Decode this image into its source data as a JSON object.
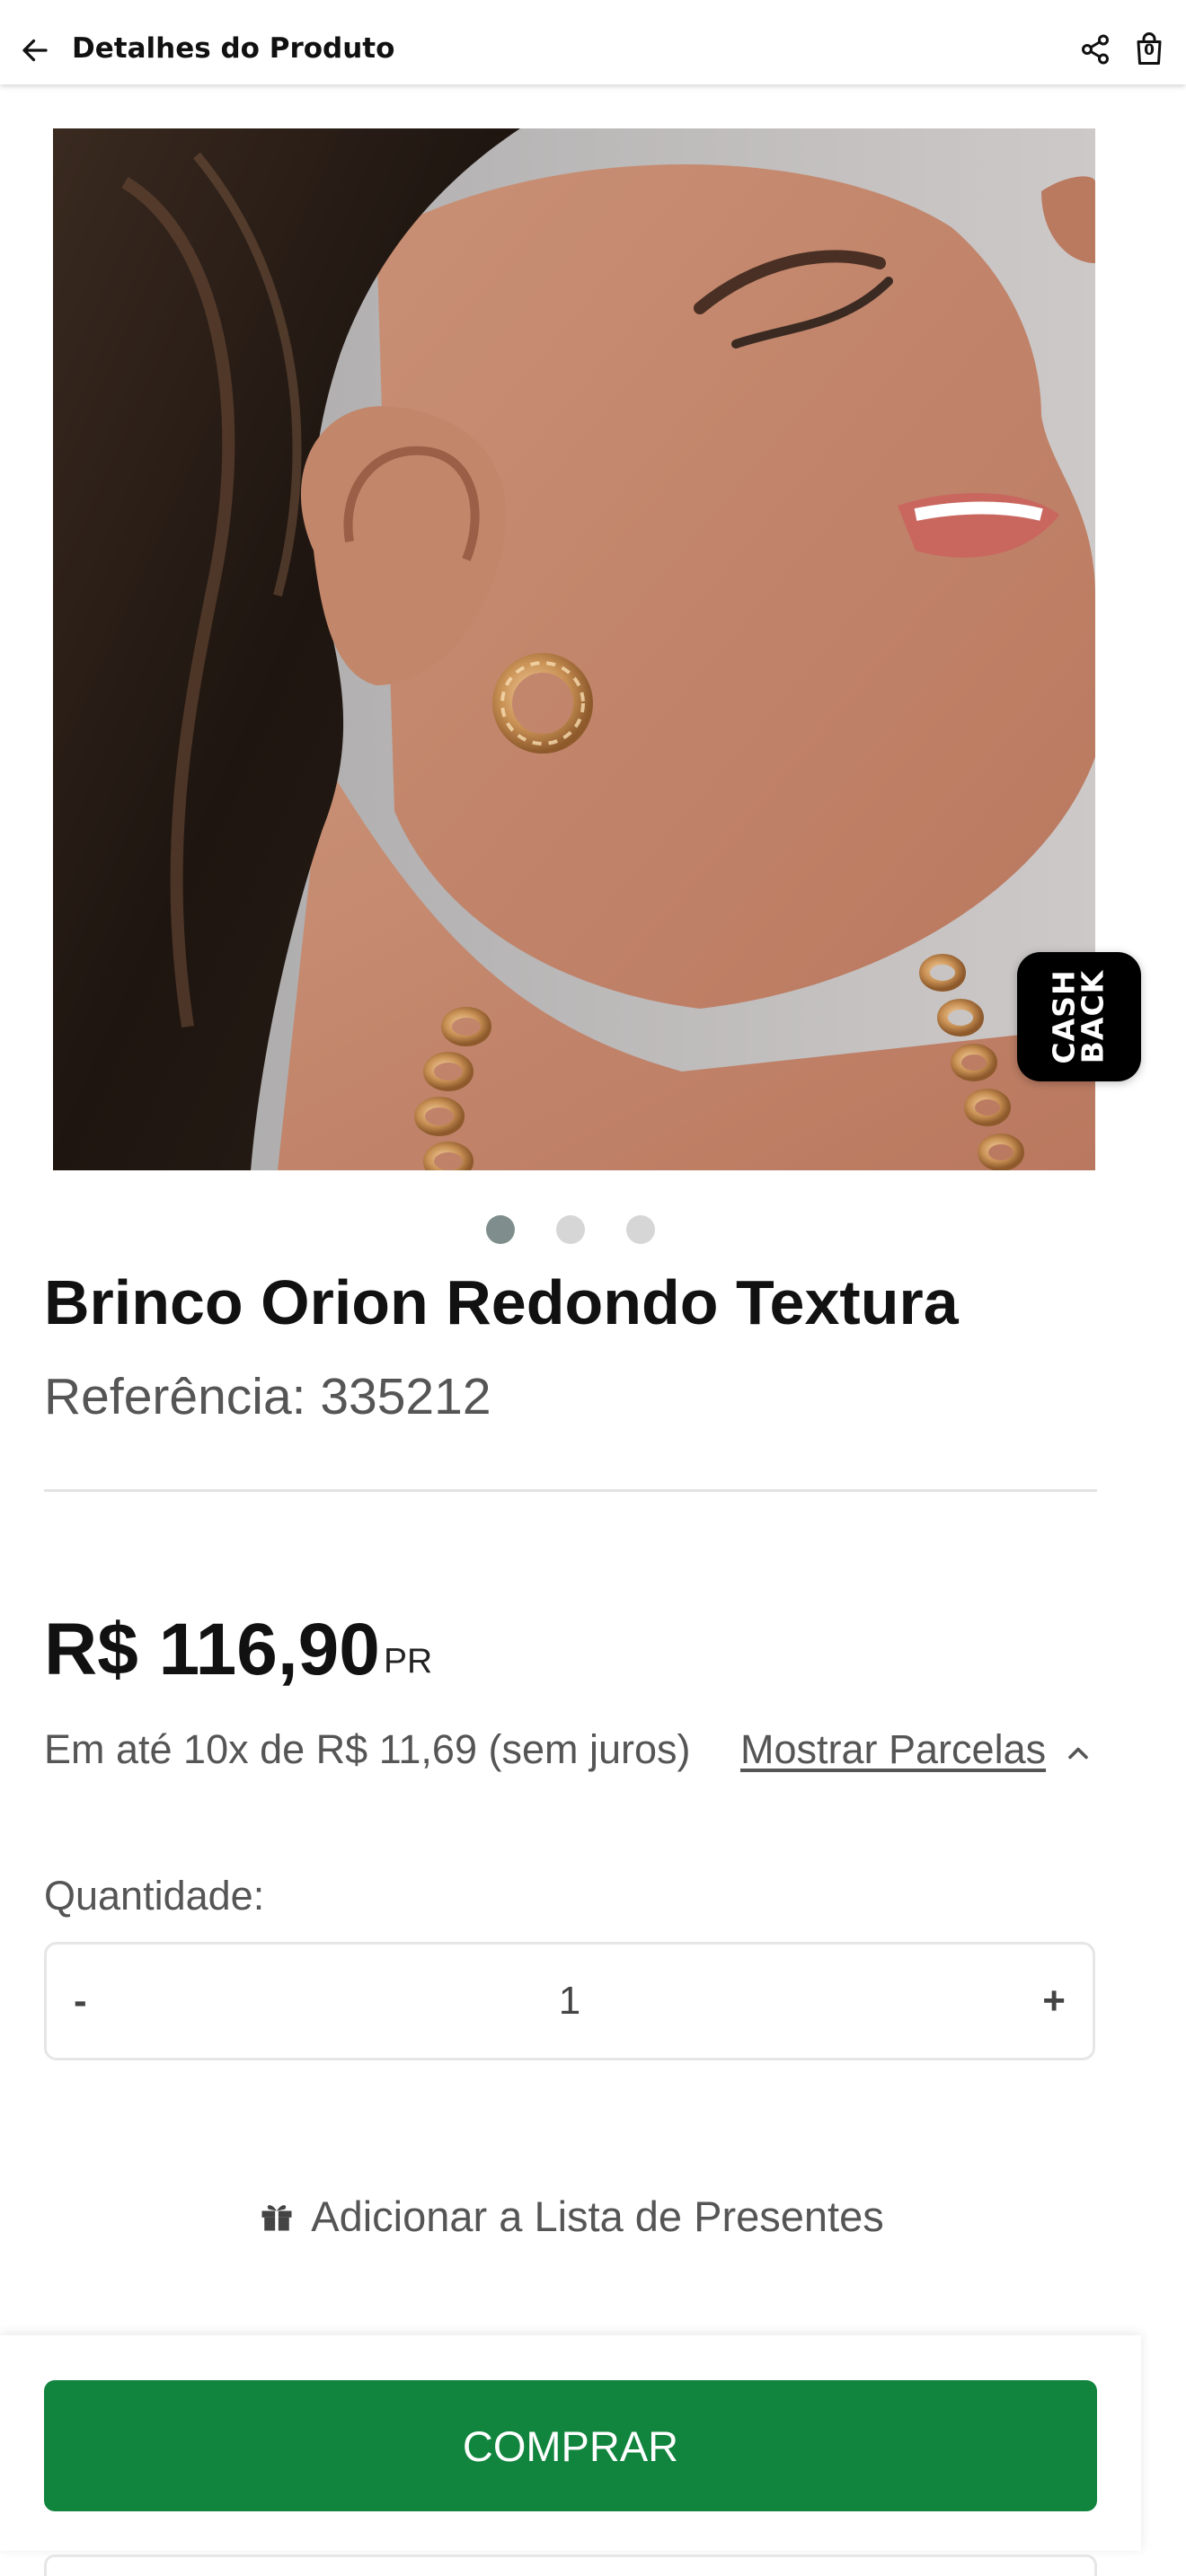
{
  "header": {
    "title": "Detalhes do Produto",
    "bag_count": "0"
  },
  "product": {
    "name": "Brinco Orion Redondo Textura",
    "reference": "Referência: 335212",
    "image_dots": 3,
    "active_dot": 0,
    "cashback_label": "CASH\nBACK"
  },
  "pricing": {
    "price": "R$ 116,90",
    "price_suffix": "PR",
    "installments": "Em até 10x de R$ 11,69 (sem juros)",
    "show_installments": "Mostrar Parcelas"
  },
  "quantity": {
    "label": "Quantidade:",
    "minus": "-",
    "value": "1",
    "plus": "+"
  },
  "gift": {
    "label": "Adicionar a Lista de Presentes"
  },
  "buy": {
    "label": "COMPRAR",
    "color": "#11843e"
  }
}
